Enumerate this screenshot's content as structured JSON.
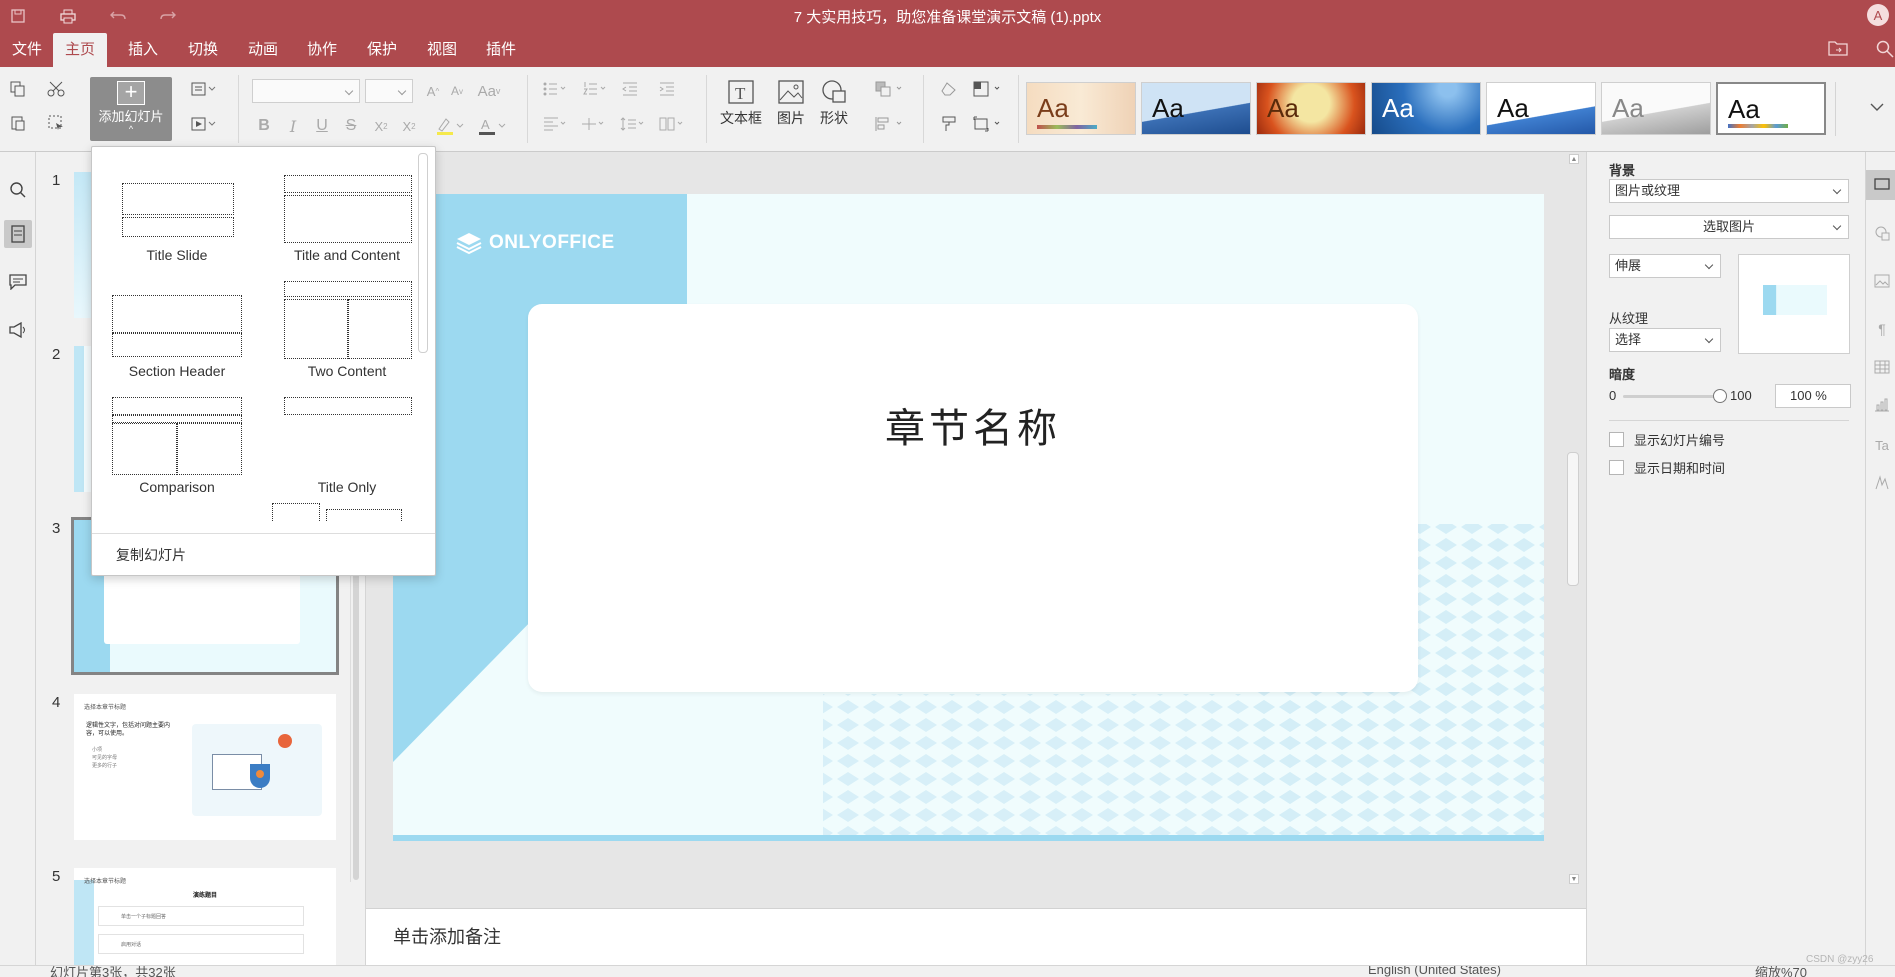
{
  "window": {
    "title": "7 大实用技巧，助您准备课堂演示文稿 (1).pptx",
    "avatar_letter": "A"
  },
  "menu": {
    "tabs": [
      "文件",
      "主页",
      "插入",
      "切换",
      "动画",
      "协作",
      "保护",
      "视图",
      "插件"
    ],
    "active": "主页"
  },
  "toolbar": {
    "add_slide_label": "添加幻灯片",
    "text_box_label": "文本框",
    "picture_label": "图片",
    "shape_label": "形状",
    "themes": [
      {
        "label": "Aa",
        "name": "theme-1"
      },
      {
        "label": "Aa",
        "name": "theme-2"
      },
      {
        "label": "Aa",
        "name": "theme-3"
      },
      {
        "label": "Aa",
        "name": "theme-4"
      },
      {
        "label": "Aa",
        "name": "theme-5"
      },
      {
        "label": "Aa",
        "name": "theme-6"
      },
      {
        "label": "Aa",
        "name": "theme-7"
      }
    ]
  },
  "layout_menu": {
    "items": [
      {
        "label": "Title Slide"
      },
      {
        "label": "Title and Content"
      },
      {
        "label": "Section Header"
      },
      {
        "label": "Two Content"
      },
      {
        "label": "Comparison"
      },
      {
        "label": "Title Only"
      }
    ],
    "duplicate_label": "复制幻灯片"
  },
  "thumbnails": {
    "numbers": [
      "1",
      "2",
      "3",
      "4",
      "5"
    ],
    "selected": "3",
    "slide4_lines": [
      "选择本章节标题",
      "逻辑性文字，包括对问题主要内容，可以使用。",
      "小项",
      "可见的字母",
      "更多的行子"
    ],
    "slide5_lines": [
      "选择本章节标题",
      "演练题目",
      "单击一个子标题回答",
      "启用对话"
    ]
  },
  "slide": {
    "logo": "ONLYOFFICE",
    "title": "章节名称",
    "accent_color": "#9cd9f0"
  },
  "notes": {
    "placeholder": "单击添加备注"
  },
  "right_panel": {
    "background_label": "背景",
    "fill_type": "图片或纹理",
    "select_picture": "选取图片",
    "stretch": "伸展",
    "from_texture_label": "从纹理",
    "texture_select": "选择",
    "transparency_label": "暗度",
    "slider_min": "0",
    "slider_max": "100",
    "transparency_value": "100 %",
    "show_slide_number": "显示幻灯片编号",
    "show_date_time": "显示日期和时间"
  },
  "statusbar": {
    "slide_info": "幻灯片第3张，共32张",
    "language": "English (United States)",
    "zoom": "缩放%70",
    "watermark": "CSDN @zyy26"
  }
}
